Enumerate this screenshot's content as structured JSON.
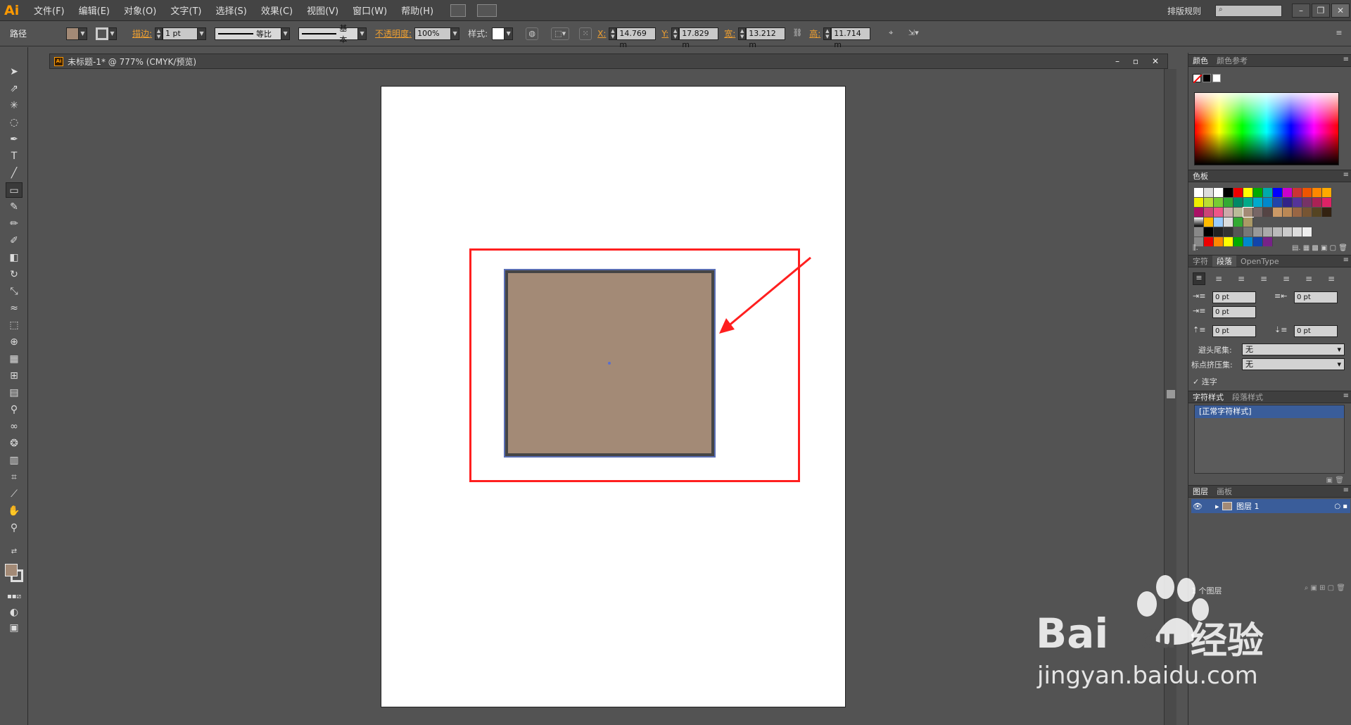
{
  "app": {
    "logo": "Ai",
    "menu": [
      "文件(F)",
      "编辑(E)",
      "对象(O)",
      "文字(T)",
      "选择(S)",
      "效果(C)",
      "视图(V)",
      "窗口(W)",
      "帮助(H)"
    ],
    "workspace": "排版规则"
  },
  "control": {
    "object_type": "路径",
    "stroke_label": "描边:",
    "stroke_weight": "1 pt",
    "profile": "等比",
    "brush": "基本",
    "opacity_label": "不透明度:",
    "opacity": "100%",
    "style_label": "样式:",
    "x_label": "X:",
    "x": "14.769 m",
    "y_label": "Y:",
    "y": "17.829 m",
    "w_label": "宽:",
    "w": "13.212 m",
    "h_label": "高:",
    "h": "11.714 m"
  },
  "document": {
    "title": "未标题-1* @ 777% (CMYK/预览)"
  },
  "colors": {
    "fill": "#a38a76",
    "selection": "#5a6fb5",
    "annotation": "#ff1f1f"
  },
  "panels": {
    "color_tabs": [
      "颜色",
      "颜色参考"
    ],
    "swatches_tab": "色板",
    "char_tabs": [
      "字符",
      "段落",
      "OpenType"
    ],
    "indent_values": [
      "0 pt",
      "0 pt",
      "0 pt",
      "0 pt",
      "0 pt"
    ],
    "kinsoku_label": "避头尾集:",
    "kinsoku_value": "无",
    "mojikumi_label": "标点挤压集:",
    "mojikumi_value": "无",
    "ligature_label": "连字",
    "style_tabs": [
      "字符样式",
      "段落样式"
    ],
    "normal_char_style": "[正常字符样式]",
    "layer_tabs": [
      "图层",
      "画板"
    ],
    "layer_name": "图层 1",
    "layer_count": "1 个图层"
  },
  "watermark": {
    "brand": "Bai",
    "brand2": "du",
    "cn": "经验",
    "url": "jingyan.baidu.com"
  }
}
